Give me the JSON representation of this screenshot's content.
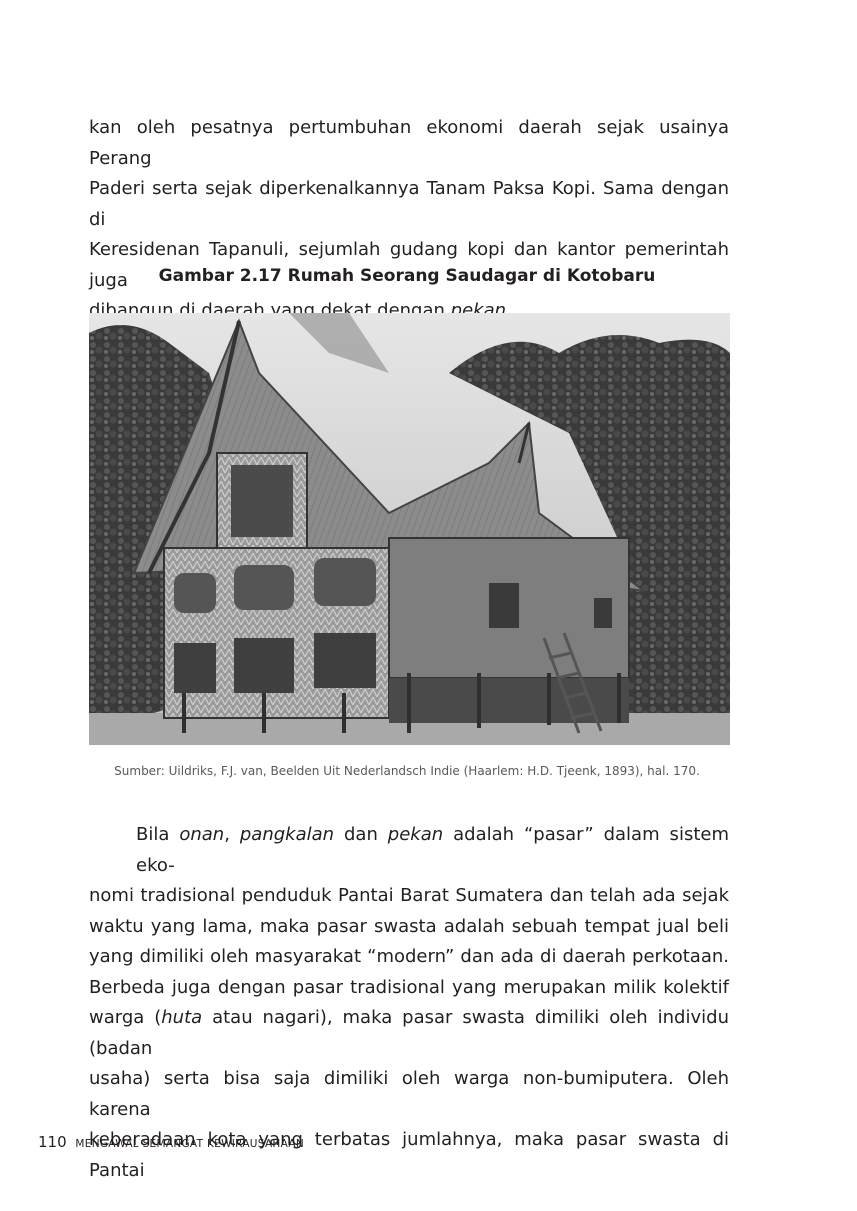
{
  "paragraph1": {
    "lines": [
      "kan oleh pesatnya pertumbuhan ekonomi daerah sejak usainya Perang",
      "Paderi serta sejak diperkenalkannya Tanam Paksa Kopi. Sama dengan di",
      "Keresidenan Tapanuli, sejumlah gudang kopi dan kantor pemerintah juga"
    ],
    "last_line_prefix": "dibangun di daerah yang dekat dengan ",
    "last_line_italic": "pekan",
    "last_line_suffix": "."
  },
  "figure": {
    "caption": "Gambar 2.17 Rumah Seorang Saudagar di Kotobaru",
    "source": "Sumber: Uildriks, F.J. van, Beelden Uit Nederlandsch Indie (Haarlem: H.D. Tjeenk, 1893), hal. 170."
  },
  "paragraph2": {
    "l1": [
      "Bila ",
      "onan",
      ", ",
      "pangkalan",
      " dan ",
      "pekan",
      " adalah “pasar” dalam sistem eko-"
    ],
    "l2": "nomi tradisional penduduk Pantai Barat Sumatera dan telah ada sejak",
    "l3": "waktu yang lama, maka pasar swasta adalah sebuah tempat jual beli",
    "l4": "yang dimiliki oleh masyarakat “modern” dan ada di daerah perkotaan.",
    "l5": "Berbeda juga dengan pasar tradisional yang merupakan milik kolektif",
    "l6": [
      "warga (",
      "huta",
      " atau nagari), maka pasar swasta dimiliki oleh individu (badan"
    ],
    "l7": "usaha) serta bisa saja dimiliki oleh warga non-bumiputera. Oleh karena",
    "l8": "keberadaan kota yang terbatas jumlahnya, maka pasar swasta di Pantai"
  },
  "footer": {
    "page_number": "110",
    "book_title": "MENGAWAL SEMANGAT KEWIRAUSAHAAN"
  }
}
